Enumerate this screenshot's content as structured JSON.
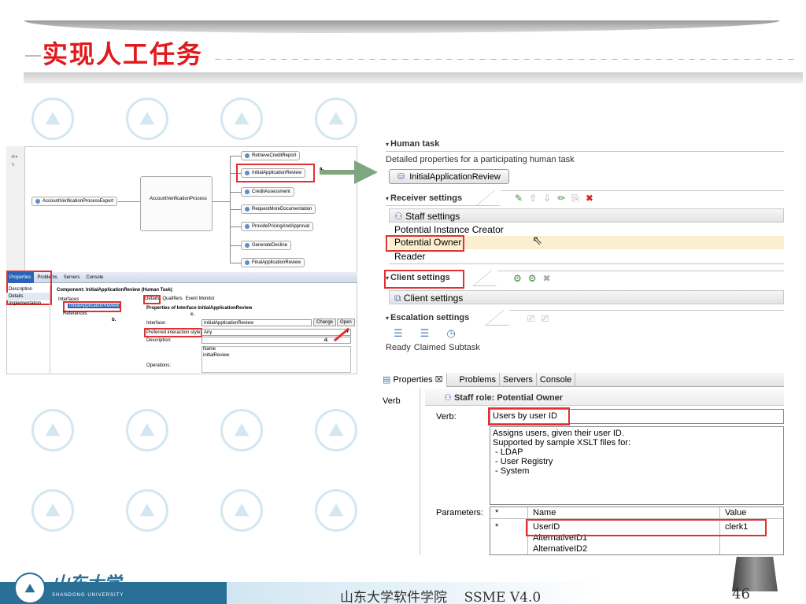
{
  "slide": {
    "title": "实现人工任务",
    "footer_text": "山东大学软件学院    SSME V4.0",
    "page_number": "46",
    "logo_calligraphy": "山东大学",
    "logo_caption": "SHANDONG UNIVERSITY",
    "title_color": "#e0191c",
    "footer_color": "#2a6f96"
  },
  "diagram": {
    "export_node": "AccountVerificationProcessExport",
    "process_node": "AccountVerificationProcess",
    "targets": [
      "RetrieveCreditReport",
      "InitialApplicationReview",
      "CreditAssessment",
      "RequestMoreDocumentation",
      "ProvidePricingAndApproval",
      "GenerateDecline",
      "FinalApplicationReview"
    ],
    "marker_a": "a."
  },
  "left_props": {
    "tabs": [
      "Properties",
      "Problems",
      "Servers",
      "Console"
    ],
    "side_items": [
      "Description",
      "Details",
      "Implementation"
    ],
    "component_title": "Component: InitialApplicationReview (Human Task)",
    "tree": [
      "Interfaces",
      "InitialApplicationReview",
      "References"
    ],
    "detail_tabs": [
      "Details",
      "Qualifiers",
      "Event Monitor"
    ],
    "properties_title": "Properties of Interface InitialApplicationReview",
    "interface_label": "Interface:",
    "interface_value": "InitialApplicationReview",
    "change_button": "Change",
    "open_button": "Open",
    "interaction_label": "Preferred interaction style:",
    "interaction_value": "Any",
    "description_label": "Description:",
    "operations_label": "Operations:",
    "ops_header": "Name",
    "ops_value": "initialReview",
    "marker_b": "b.",
    "marker_c": "c.",
    "marker_d": "d."
  },
  "human_task": {
    "header": "Human task",
    "subtitle": "Detailed properties for a participating human task",
    "task_button": "InitialApplicationReview",
    "receiver_header": "Receiver settings",
    "staff_settings": "Staff settings",
    "receivers": [
      "Potential Instance Creator",
      "Potential Owner",
      "Reader"
    ],
    "client_header": "Client settings",
    "client_item": "Client settings",
    "escalation_header": "Escalation settings",
    "escalation_items": [
      "Ready",
      "Claimed",
      "Subtask"
    ]
  },
  "staff_props": {
    "tabs": [
      "Properties ☒",
      "Problems",
      "Servers",
      "Console"
    ],
    "side_item": "Verb",
    "header": "Staff role: Potential Owner",
    "verb_label": "Verb:",
    "verb_value": "Users by user ID",
    "description_lines": [
      "Assigns users, given their user ID.",
      "Supported by sample XSLT files for:",
      " - LDAP",
      " - User Registry",
      " - System"
    ],
    "parameters_label": "Parameters:",
    "grid_headers": [
      "*",
      "Name",
      "Value"
    ],
    "grid_rows": [
      {
        "star": "*",
        "name": "UserID",
        "value": "clerk1"
      },
      {
        "star": "",
        "name": "AlternativeID1",
        "value": ""
      },
      {
        "star": "",
        "name": "AlternativeID2",
        "value": ""
      }
    ]
  }
}
